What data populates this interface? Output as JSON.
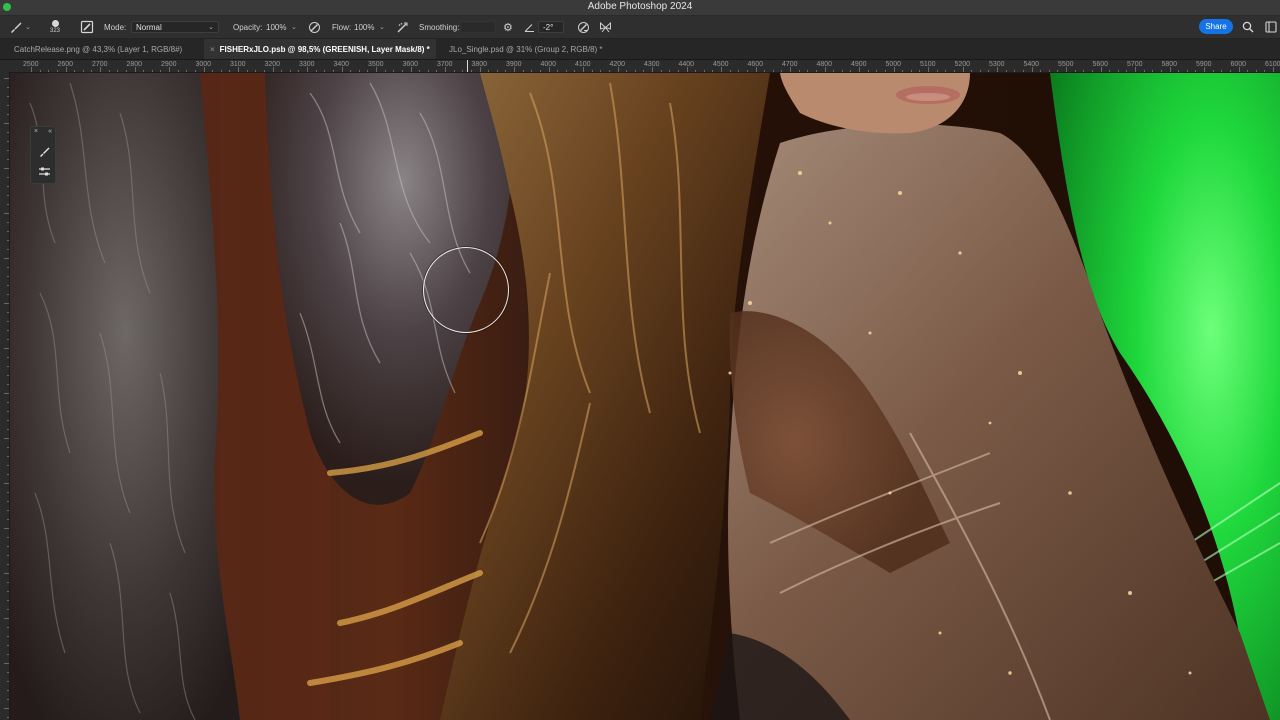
{
  "app": {
    "window_title": "Adobe Photoshop 2024"
  },
  "options_bar": {
    "brush_size": "323",
    "mode_label": "Mode:",
    "mode_value": "Normal",
    "opacity_label": "Opacity:",
    "opacity_value": "100%",
    "flow_label": "Flow:",
    "flow_value": "100%",
    "smoothing_label": "Smoothing:",
    "smoothing_value": "",
    "angle_value": "-2°",
    "share_label": "Share"
  },
  "tabs": [
    {
      "label": "CatchRelease.png @ 43,3% (Layer 1, RGB/8#)",
      "active": false
    },
    {
      "label": "FISHERxJLO.psb @ 98,5% (GREENISH, Layer Mask/8) *",
      "active": true
    },
    {
      "label": "JLo_Single.psd @ 31% (Group 2, RGB/8) *",
      "active": false
    }
  ],
  "ruler": {
    "labels": [
      "2500",
      "2600",
      "2700",
      "2800",
      "2900",
      "3000",
      "3100",
      "3200",
      "3300",
      "3400",
      "3500",
      "3600",
      "3700",
      "3800",
      "3900",
      "4000",
      "4100",
      "4200",
      "4300",
      "4400",
      "4500",
      "4600",
      "4700",
      "4800",
      "4900",
      "5000",
      "5100",
      "5200",
      "5300",
      "5400",
      "5500",
      "5600",
      "5700",
      "5800",
      "5900",
      "6000",
      "6100"
    ]
  },
  "colors": {
    "accent": "#1473e6",
    "window_dot": "#2fc24a",
    "green_screen": "#19d13a"
  },
  "icons": {
    "brush_tool": "brush-icon",
    "toggle_brush_panel": "brush-panel-icon",
    "pressure_opacity": "pressure-opacity-icon",
    "airbrush": "airbrush-icon",
    "smoothing_settings": "gear-icon",
    "angle": "angle-icon",
    "pressure_size": "pressure-size-icon",
    "symmetry": "butterfly-icon",
    "search": "search-icon",
    "workspace": "workspace-icon"
  }
}
